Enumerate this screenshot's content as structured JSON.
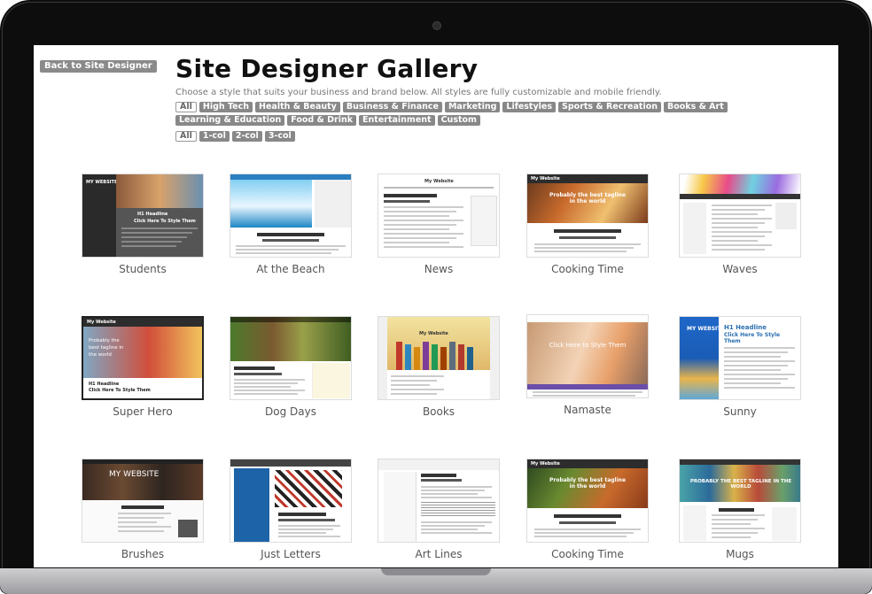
{
  "back_button": "Back to Site Designer",
  "title": "Site Designer Gallery",
  "subtitle": "Choose a style that suits your business and brand below. All styles are fully customizable and mobile friendly.",
  "category_filters": [
    "All",
    "High Tech",
    "Health & Beauty",
    "Business & Finance",
    "Marketing",
    "Lifestyles",
    "Sports & Recreation",
    "Books & Art",
    "Learning & Education",
    "Food & Drink",
    "Entertainment",
    "Custom"
  ],
  "column_filters": [
    "All",
    "1-col",
    "2-col",
    "3-col"
  ],
  "gallery": [
    {
      "name": "Students"
    },
    {
      "name": "At the Beach"
    },
    {
      "name": "News"
    },
    {
      "name": "Cooking Time"
    },
    {
      "name": "Waves"
    },
    {
      "name": "Super Hero"
    },
    {
      "name": "Dog Days"
    },
    {
      "name": "Books"
    },
    {
      "name": "Namaste"
    },
    {
      "name": "Sunny"
    },
    {
      "name": "Brushes"
    },
    {
      "name": "Just Letters"
    },
    {
      "name": "Art Lines"
    },
    {
      "name": "Cooking Time"
    },
    {
      "name": "Mugs"
    }
  ],
  "thumb_text": {
    "students_brand": "MY WEBSITE",
    "news_brand": "My Website",
    "cooking_brand": "My Website",
    "hero_brand": "My Website",
    "hero_tagline": "Probably the best tagline in the world",
    "books_brand": "My Website",
    "namaste_tagline": "Click Here to Style Them",
    "sunny_brand": "MY WEBSITE",
    "sunny_headline": "H1 Headline",
    "brushes_brand": "MY WEBSITE",
    "mugs_tagline": "PROBABLY THE BEST TAGLINE IN THE WORLD",
    "cooking_tagline": "Probably the best tagline in the world",
    "headline": "H1 Headline",
    "click_here": "Click Here To Style Them"
  },
  "colors": {
    "chip": "#888888",
    "accent_blue": "#2a6fb0"
  }
}
